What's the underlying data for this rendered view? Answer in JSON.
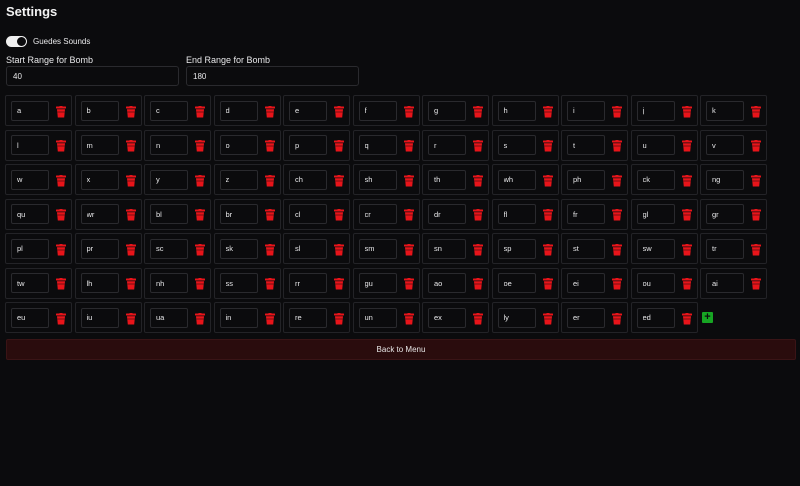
{
  "header": {
    "title": "Settings"
  },
  "sound_toggle": {
    "label": "Guedes Sounds",
    "enabled": true
  },
  "bomb_range": {
    "start_label": "Start Range for Bomb",
    "start_value": "40",
    "end_label": "End Range for Bomb",
    "end_value": "180"
  },
  "syllables": [
    "a",
    "b",
    "c",
    "d",
    "e",
    "f",
    "g",
    "h",
    "i",
    "j",
    "k",
    "l",
    "m",
    "n",
    "o",
    "p",
    "q",
    "r",
    "s",
    "t",
    "u",
    "v",
    "w",
    "x",
    "y",
    "z",
    "ch",
    "sh",
    "th",
    "wh",
    "ph",
    "ck",
    "ng",
    "qu",
    "wr",
    "bl",
    "br",
    "cl",
    "cr",
    "dr",
    "fl",
    "fr",
    "gl",
    "gr",
    "pl",
    "pr",
    "sc",
    "sk",
    "sl",
    "sm",
    "sn",
    "sp",
    "st",
    "sw",
    "tr",
    "tw",
    "lh",
    "nh",
    "ss",
    "rr",
    "gu",
    "ao",
    "oe",
    "ei",
    "ou",
    "ai",
    "eu",
    "iu",
    "ua",
    "in",
    "re",
    "un",
    "ex",
    "ly",
    "er",
    "ed"
  ],
  "icons": {
    "delete": "trash-icon",
    "add": "plus-icon"
  },
  "colors": {
    "background": "#0b0b0d",
    "delete": "#e8141a",
    "add": "#17a523",
    "back_button": "#2a0c0d"
  },
  "footer": {
    "back_label": "Back to Menu"
  }
}
